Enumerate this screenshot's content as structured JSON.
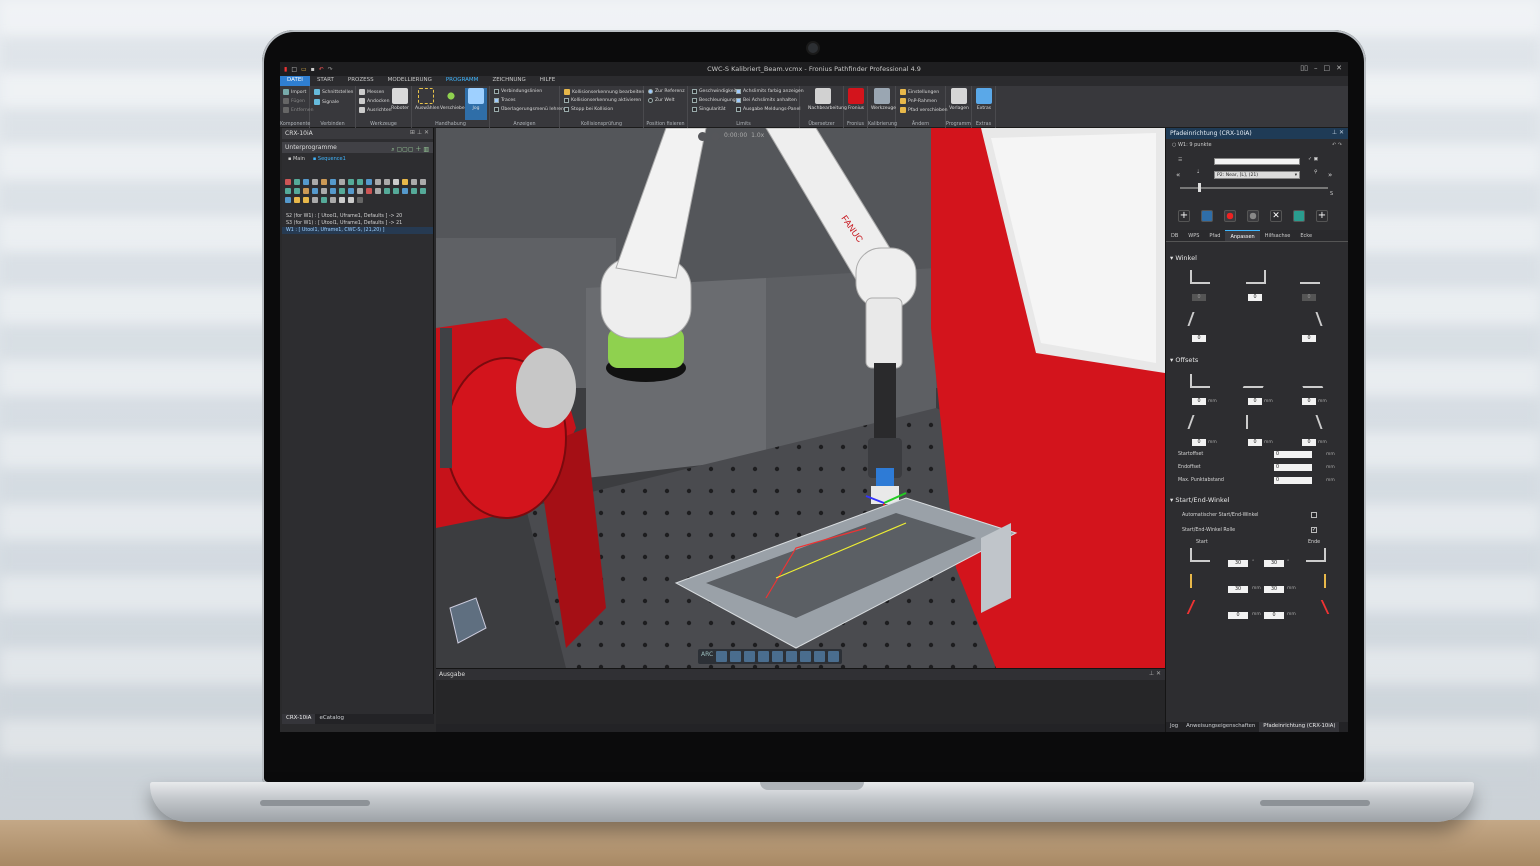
{
  "window": {
    "title": "CWC-S Kalibriert_Beam.vcmx - Fronius Pathfinder Professional 4.9"
  },
  "menu_tabs": [
    "DATEI",
    "START",
    "PROZESS",
    "MODELLIERUNG",
    "PROGRAMM",
    "ZEICHNUNG",
    "HILFE"
  ],
  "ribbon": {
    "groups": [
      {
        "caption": "Komponente",
        "items": [
          "Import",
          "Fügen",
          "Entfernen"
        ]
      },
      {
        "caption": "Verbinden",
        "items": [
          "Schnittstellen",
          "Signale"
        ]
      },
      {
        "caption": "Werkzeuge",
        "items": [
          "Messen",
          "Andocken",
          "Ausrichten",
          "Roboter"
        ]
      },
      {
        "caption": "Handhabung",
        "items": [
          "Auswählen",
          "Verschieben",
          "Jog"
        ]
      },
      {
        "caption": "Anzeigen",
        "items": [
          "Verbindungslinien",
          "Traces",
          "Überlagerungsmenü lehren"
        ]
      },
      {
        "caption": "Kollisionsprüfung",
        "items": [
          "Kollisionserkennung bearbeiten",
          "Kollisionserkennung aktivieren",
          "Stopp bei Kollision"
        ]
      },
      {
        "caption": "Position fixieren",
        "items": [
          "Zur Referenz",
          "Zur Welt"
        ]
      },
      {
        "caption": "Limits",
        "items": [
          "Geschwindigkeit",
          "Beschleunigung",
          "Singularität",
          "Achslimits farbig anzeigen",
          "Bei Achslimits anhalten",
          "Ausgabe Meldungs-Panel"
        ]
      },
      {
        "caption": "Übersetzer",
        "items": [
          "Nachbearbeitung"
        ]
      },
      {
        "caption": "Fronius",
        "items": [
          "Fronius"
        ]
      },
      {
        "caption": "Kalibrierung",
        "items": [
          "Werkzeuge"
        ]
      },
      {
        "caption": "Ändern",
        "items": [
          "Einstellungen",
          "PnP-Rahmen",
          "Pfad verschieben"
        ]
      },
      {
        "caption": "Programm",
        "items": [
          "Vorlagen"
        ]
      },
      {
        "caption": "Extras",
        "items": [
          "Extras"
        ]
      }
    ]
  },
  "left_panel": {
    "title": "CRX-10iA",
    "sub_title": "Unterprogramme",
    "tabs": [
      "Main",
      "Sequence1"
    ],
    "tree": [
      "S2 (for W1) : [ Utool1, Uframe1, Defaults ] -> 20",
      "S3 (for W1) : [ Utool1, Uframe1, Defaults ] -> 21",
      "W1 : [ Utool1, Uframe1, CWC-S, (21,20) ]"
    ],
    "footer_tabs": [
      "CRX-10iA",
      "eCatalog"
    ]
  },
  "viewport": {
    "time": "0:00:00",
    "speed": "1.0x",
    "bottom_label": "ARC",
    "brand": "FANUC"
  },
  "output_panel": {
    "title": "Ausgabe"
  },
  "right_panel": {
    "title": "Pfadeinrichtung (CRX-10iA)",
    "path_label": "W1: 9 punkte",
    "dropdown": "P2: Near, [L], (21)",
    "s_label": "S",
    "tabs": [
      "DB",
      "WPS",
      "Pfad",
      "Anpassen",
      "Hilfsachse",
      "Ecke"
    ],
    "active_tab": "Anpassen",
    "sections": {
      "winkel": "Winkel",
      "offsets": "Offsets",
      "start_end": "Start/End-Winkel"
    },
    "winkel_values": [
      "0",
      "0",
      "0",
      "0",
      "0"
    ],
    "offset_values": [
      "0",
      "0",
      "0",
      "0",
      "0",
      "0"
    ],
    "offset_unit": "mm",
    "fields": [
      {
        "label": "Startoffset",
        "value": "0",
        "unit": "mm"
      },
      {
        "label": "Endoffset",
        "value": "0",
        "unit": "mm"
      },
      {
        "label": "Max. Punktabstand",
        "value": "0",
        "unit": "mm"
      }
    ],
    "checks": [
      {
        "label": "Automatischer Start/End-Winkel",
        "checked": false
      },
      {
        "label": "Start/End-Winkel Rolle",
        "checked": true
      }
    ],
    "start_label": "Start",
    "end_label": "Ende",
    "start_end_rows": [
      {
        "start": "30",
        "start_unit": "°",
        "end": "30",
        "end_unit": "°"
      },
      {
        "start": "30",
        "start_unit": "mm",
        "end": "30",
        "end_unit": "mm"
      },
      {
        "start": "0",
        "start_unit": "mm",
        "end": "0",
        "end_unit": "mm"
      }
    ],
    "footer_tabs": [
      "Jog",
      "Anweisungseigenschaften",
      "Pfadeinrichtung (CRX-10iA)"
    ]
  },
  "colors": {
    "accent": "#2f7fd2",
    "cell_red": "#d3141c",
    "robot_white": "#eeeeee",
    "robot_green": "#8fd14f"
  }
}
